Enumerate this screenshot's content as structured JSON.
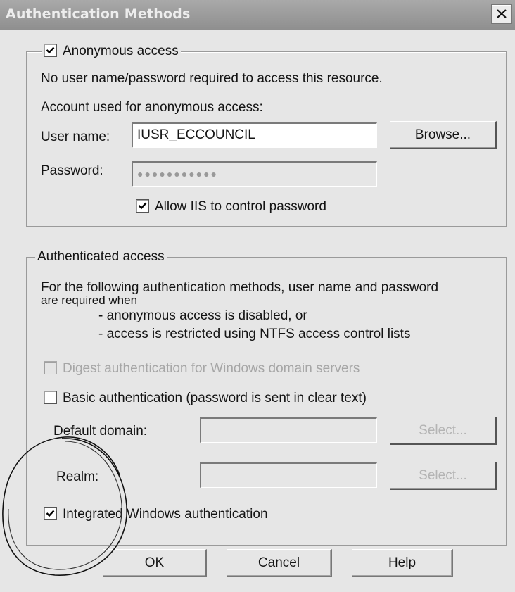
{
  "window": {
    "title": "Authentication Methods",
    "close_label": "×"
  },
  "anonymous": {
    "legend": "Anonymous access",
    "checked": true,
    "description": "No user name/password required to access this resource.",
    "account_label": "Account used for anonymous access:",
    "username_label": "User name:",
    "username_value": "IUSR_ECCOUNCIL",
    "browse_label": "Browse...",
    "password_label": "Password:",
    "password_value": "●●●●●●●●●●●",
    "allow_iis_label": "Allow IIS to control password",
    "allow_iis_checked": true
  },
  "authenticated": {
    "legend": "Authenticated access",
    "description_line1": "For the following authentication methods, user name and password",
    "description_line2": "are required when",
    "bullet1": "- anonymous access is disabled, or",
    "bullet2": "- access is restricted using NTFS access control lists",
    "digest_label": "Digest authentication for Windows domain servers",
    "digest_checked": false,
    "digest_enabled": false,
    "basic_label": "Basic authentication (password is sent in clear text)",
    "basic_checked": false,
    "default_domain_label": "Default domain:",
    "default_domain_value": "",
    "select_label_1": "Select...",
    "realm_label": "Realm:",
    "realm_value": "",
    "select_label_2": "Select...",
    "integrated_label": "Integrated Windows authentication",
    "integrated_checked": true
  },
  "buttons": {
    "ok": "OK",
    "cancel": "Cancel",
    "help": "Help"
  }
}
